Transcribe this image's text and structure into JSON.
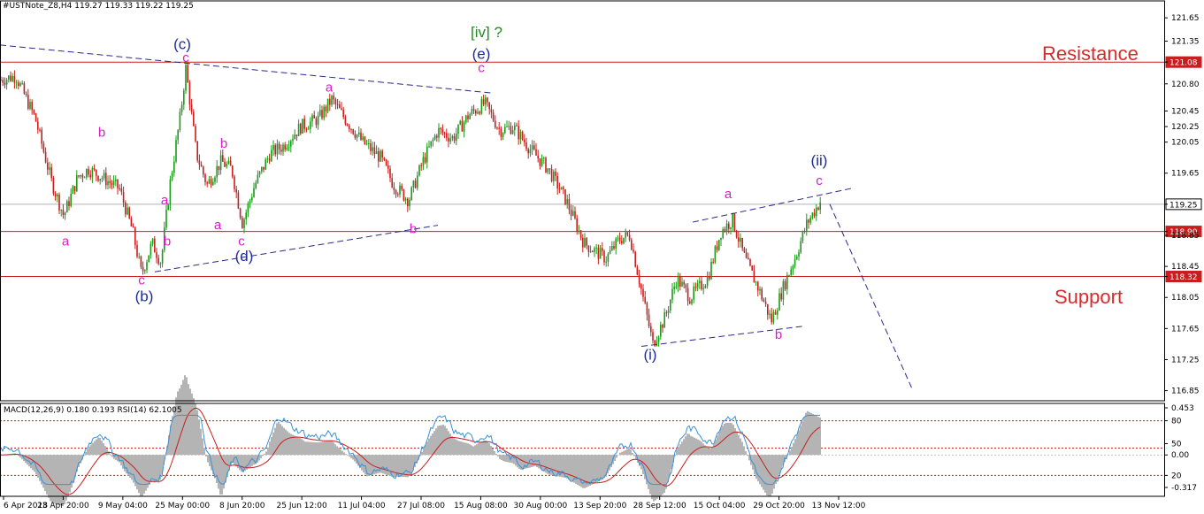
{
  "header": {
    "symbol_info": "#USTNote_Z8,H4  119.27 119.33 119.22 119.25"
  },
  "indicator": {
    "label": "MACD(12,26,9) 0.180 0.193  RSI(14) 62.1005"
  },
  "labels": {
    "resistance": "Resistance",
    "support": "Support"
  },
  "colors": {
    "bull": "#1a9b1a",
    "bear": "#c81e1e",
    "level": "#c81e1e",
    "wave_blue": "#1e2b9a",
    "wave_magenta": "#d81ec8",
    "wave_green": "#1f8a1f",
    "macd_hist": "#b4b4b4",
    "rsi": "#3a8fd8",
    "signal": "#c81e1e"
  },
  "chart_data": [
    {
      "type": "candlestick",
      "title": "#USTNote_Z8,H4",
      "ylim": [
        116.72,
        121.72
      ],
      "y_ticks": [
        "121.65",
        "121.35",
        "121.08",
        "120.80",
        "120.45",
        "120.25",
        "120.05",
        "119.65",
        "119.25",
        "118.90",
        "118.85",
        "118.45",
        "118.32",
        "118.05",
        "117.65",
        "117.25",
        "116.85"
      ],
      "x_ticks": [
        "6 Apr 2018",
        "23 Apr 20:00",
        "9 May 04:00",
        "25 May 00:00",
        "8 Jun 20:00",
        "25 Jun 12:00",
        "11 Jul 04:00",
        "27 Jul 08:00",
        "15 Aug 08:00",
        "30 Aug 00:00",
        "13 Sep 20:00",
        "28 Sep 12:00",
        "15 Oct 04:00",
        "29 Oct 20:00",
        "13 Nov 12:00"
      ],
      "price_path": [
        [
          0,
          120.85
        ],
        [
          18,
          120.9
        ],
        [
          40,
          120.35
        ],
        [
          58,
          119.55
        ],
        [
          72,
          119.1
        ],
        [
          88,
          119.6
        ],
        [
          100,
          119.7
        ],
        [
          115,
          119.6
        ],
        [
          135,
          119.45
        ],
        [
          150,
          118.9
        ],
        [
          160,
          118.35
        ],
        [
          172,
          118.75
        ],
        [
          182,
          118.5
        ],
        [
          192,
          119.5
        ],
        [
          204,
          120.4
        ],
        [
          210,
          121.0
        ],
        [
          222,
          119.9
        ],
        [
          234,
          119.5
        ],
        [
          250,
          119.8
        ],
        [
          262,
          119.7
        ],
        [
          274,
          119.0
        ],
        [
          288,
          119.5
        ],
        [
          305,
          119.9
        ],
        [
          320,
          120.0
        ],
        [
          340,
          120.25
        ],
        [
          360,
          120.35
        ],
        [
          375,
          120.6
        ],
        [
          390,
          120.35
        ],
        [
          410,
          120.05
        ],
        [
          430,
          119.85
        ],
        [
          445,
          119.5
        ],
        [
          462,
          119.3
        ],
        [
          478,
          119.8
        ],
        [
          495,
          120.2
        ],
        [
          512,
          120.1
        ],
        [
          530,
          120.4
        ],
        [
          548,
          120.55
        ],
        [
          565,
          120.2
        ],
        [
          580,
          120.25
        ],
        [
          600,
          119.95
        ],
        [
          620,
          119.7
        ],
        [
          640,
          119.3
        ],
        [
          660,
          118.75
        ],
        [
          685,
          118.55
        ],
        [
          700,
          118.8
        ],
        [
          712,
          118.85
        ],
        [
          724,
          118.2
        ],
        [
          738,
          117.45
        ],
        [
          752,
          117.8
        ],
        [
          765,
          118.3
        ],
        [
          780,
          118.05
        ],
        [
          800,
          118.3
        ],
        [
          815,
          118.9
        ],
        [
          828,
          119.05
        ],
        [
          842,
          118.55
        ],
        [
          858,
          118.15
        ],
        [
          872,
          117.75
        ],
        [
          886,
          118.2
        ],
        [
          900,
          118.6
        ],
        [
          912,
          119.0
        ],
        [
          920,
          119.15
        ],
        [
          928,
          119.3
        ]
      ],
      "levels": [
        {
          "label": "121.08",
          "value": 121.08
        },
        {
          "label": "119.25",
          "value": 119.25
        },
        {
          "label": "118.90",
          "value": 118.9
        },
        {
          "label": "118.32",
          "value": 118.32
        }
      ],
      "wave_labels": [
        {
          "text": "(c)",
          "color": "blue",
          "x": 206,
          "y": 121.25
        },
        {
          "text": "c",
          "color": "magenta",
          "x": 210,
          "y": 121.08
        },
        {
          "text": "[iv] ?",
          "color": "green",
          "x": 550,
          "y": 121.4
        },
        {
          "text": "(e)",
          "color": "blue",
          "x": 544,
          "y": 121.12
        },
        {
          "text": "c",
          "color": "magenta",
          "x": 544,
          "y": 120.95
        },
        {
          "text": "a",
          "color": "magenta",
          "x": 372,
          "y": 120.7
        },
        {
          "text": "b",
          "color": "magenta",
          "x": 115,
          "y": 120.12
        },
        {
          "text": "b",
          "color": "magenta",
          "x": 253,
          "y": 119.98
        },
        {
          "text": "a",
          "color": "magenta",
          "x": 186,
          "y": 119.25
        },
        {
          "text": "a",
          "color": "magenta",
          "x": 74,
          "y": 118.72
        },
        {
          "text": "a",
          "color": "magenta",
          "x": 246,
          "y": 118.93
        },
        {
          "text": "b",
          "color": "magenta",
          "x": 189,
          "y": 118.72
        },
        {
          "text": "c",
          "color": "magenta",
          "x": 273,
          "y": 118.72
        },
        {
          "text": "(d)",
          "color": "blue",
          "x": 276,
          "y": 118.52
        },
        {
          "text": "b",
          "color": "magenta",
          "x": 467,
          "y": 118.88
        },
        {
          "text": "c",
          "color": "magenta",
          "x": 160,
          "y": 118.22
        },
        {
          "text": "(b)",
          "color": "blue",
          "x": 163,
          "y": 118.0
        },
        {
          "text": "(i)",
          "color": "blue",
          "x": 735,
          "y": 117.25
        },
        {
          "text": "a",
          "color": "magenta",
          "x": 823,
          "y": 119.33
        },
        {
          "text": "b",
          "color": "magenta",
          "x": 880,
          "y": 117.52
        },
        {
          "text": "(ii)",
          "color": "blue",
          "x": 926,
          "y": 119.75
        },
        {
          "text": "c",
          "color": "magenta",
          "x": 926,
          "y": 119.5
        }
      ],
      "trendlines": [
        {
          "points": [
            [
              0,
              121.3
            ],
            [
              558,
              120.68
            ]
          ]
        },
        {
          "points": [
            [
              175,
              118.38
            ],
            [
              495,
              118.98
            ]
          ]
        },
        {
          "points": [
            [
              725,
              117.42
            ],
            [
              908,
              117.68
            ]
          ]
        },
        {
          "points": [
            [
              783,
              119.02
            ],
            [
              965,
              119.46
            ]
          ]
        },
        {
          "points": [
            [
              938,
              119.25
            ],
            [
              1032,
              116.85
            ]
          ]
        }
      ]
    },
    {
      "type": "line",
      "title": "MACD(12,26,9) 0.180 0.193 RSI(14) 62.1005",
      "ylim": [
        -0.4,
        0.5
      ],
      "y_ticks": [
        "0.453",
        "80",
        "50",
        "0.00",
        "20",
        "-0.317"
      ],
      "series": [
        {
          "name": "MACD"
        },
        {
          "name": "Signal"
        },
        {
          "name": "RSI(14)"
        }
      ]
    }
  ]
}
